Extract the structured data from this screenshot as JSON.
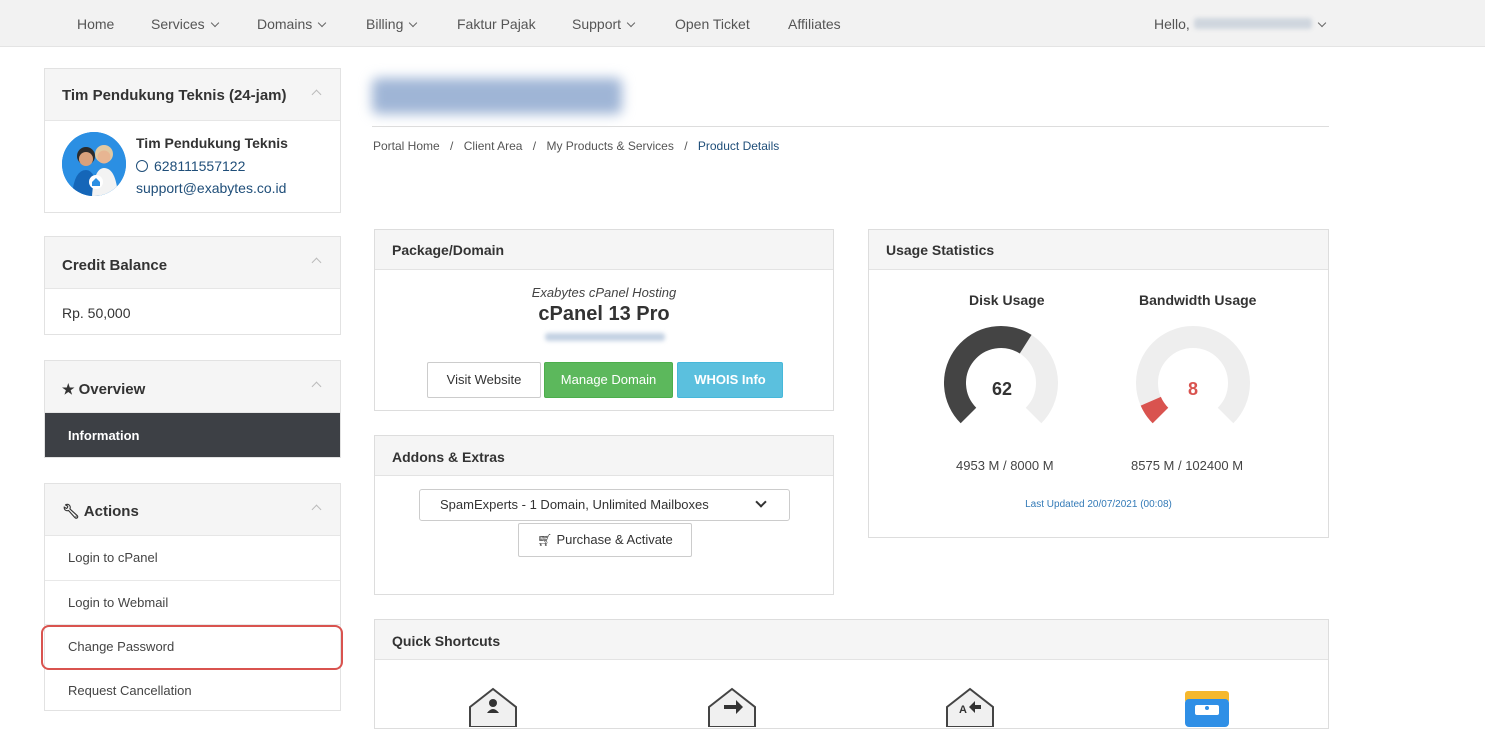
{
  "nav": {
    "home": "Home",
    "services": "Services",
    "domains": "Domains",
    "billing": "Billing",
    "faktur": "Faktur Pajak",
    "support": "Support",
    "open_ticket": "Open Ticket",
    "affiliates": "Affiliates",
    "hello": "Hello,"
  },
  "support_panel": {
    "title": "Tim Pendukung Teknis (24-jam)",
    "name": "Tim Pendukung Teknis",
    "phone": "628111557122",
    "email": "support@exabytes.co.id"
  },
  "credit_panel": {
    "title": "Credit Balance",
    "amount": "Rp. 50,000"
  },
  "overview_panel": {
    "title": "Overview",
    "active_item": "Information"
  },
  "actions_panel": {
    "title": "Actions",
    "items": [
      "Login to cPanel",
      "Login to Webmail",
      "Change Password",
      "Request Cancellation"
    ]
  },
  "breadcrumb": {
    "items": [
      "Portal Home",
      "Client Area",
      "My Products & Services"
    ],
    "current": "Product Details",
    "separator": "/"
  },
  "package": {
    "heading": "Package/Domain",
    "product_group": "Exabytes cPanel Hosting",
    "product_name": "cPanel 13 Pro",
    "visit_label": "Visit Website",
    "manage_label": "Manage Domain",
    "whois_label": "WHOIS Info"
  },
  "addons": {
    "heading": "Addons & Extras",
    "selected": "SpamExperts - 1 Domain, Unlimited Mailboxes",
    "purchase_label": "Purchase & Activate"
  },
  "usage": {
    "heading": "Usage Statistics",
    "disk_label": "Disk Usage",
    "disk_percent": 62,
    "disk_value": "4953 M / 8000 M",
    "bandwidth_label": "Bandwidth Usage",
    "bandwidth_percent": 8,
    "bandwidth_value": "8575 M / 102400 M",
    "last_updated": "Last Updated 20/07/2021 (00:08)"
  },
  "shortcuts": {
    "heading": "Quick Shortcuts"
  },
  "colors": {
    "green": "#5cb85c",
    "cyan": "#5bc0de",
    "dark": "#3d4045",
    "link": "#1f4e79",
    "blue_link": "#337ab7",
    "gauge_dark": "#444444",
    "gauge_red": "#d9534f",
    "highlight": "#d9534f"
  },
  "icons": [
    "chevron-down-icon",
    "whatsapp-icon",
    "star-icon",
    "wrench-icon",
    "cart-icon",
    "select-chevron-icon",
    "email-account-icon",
    "email-forward-icon",
    "autoresponder-icon",
    "inbox-icon"
  ]
}
